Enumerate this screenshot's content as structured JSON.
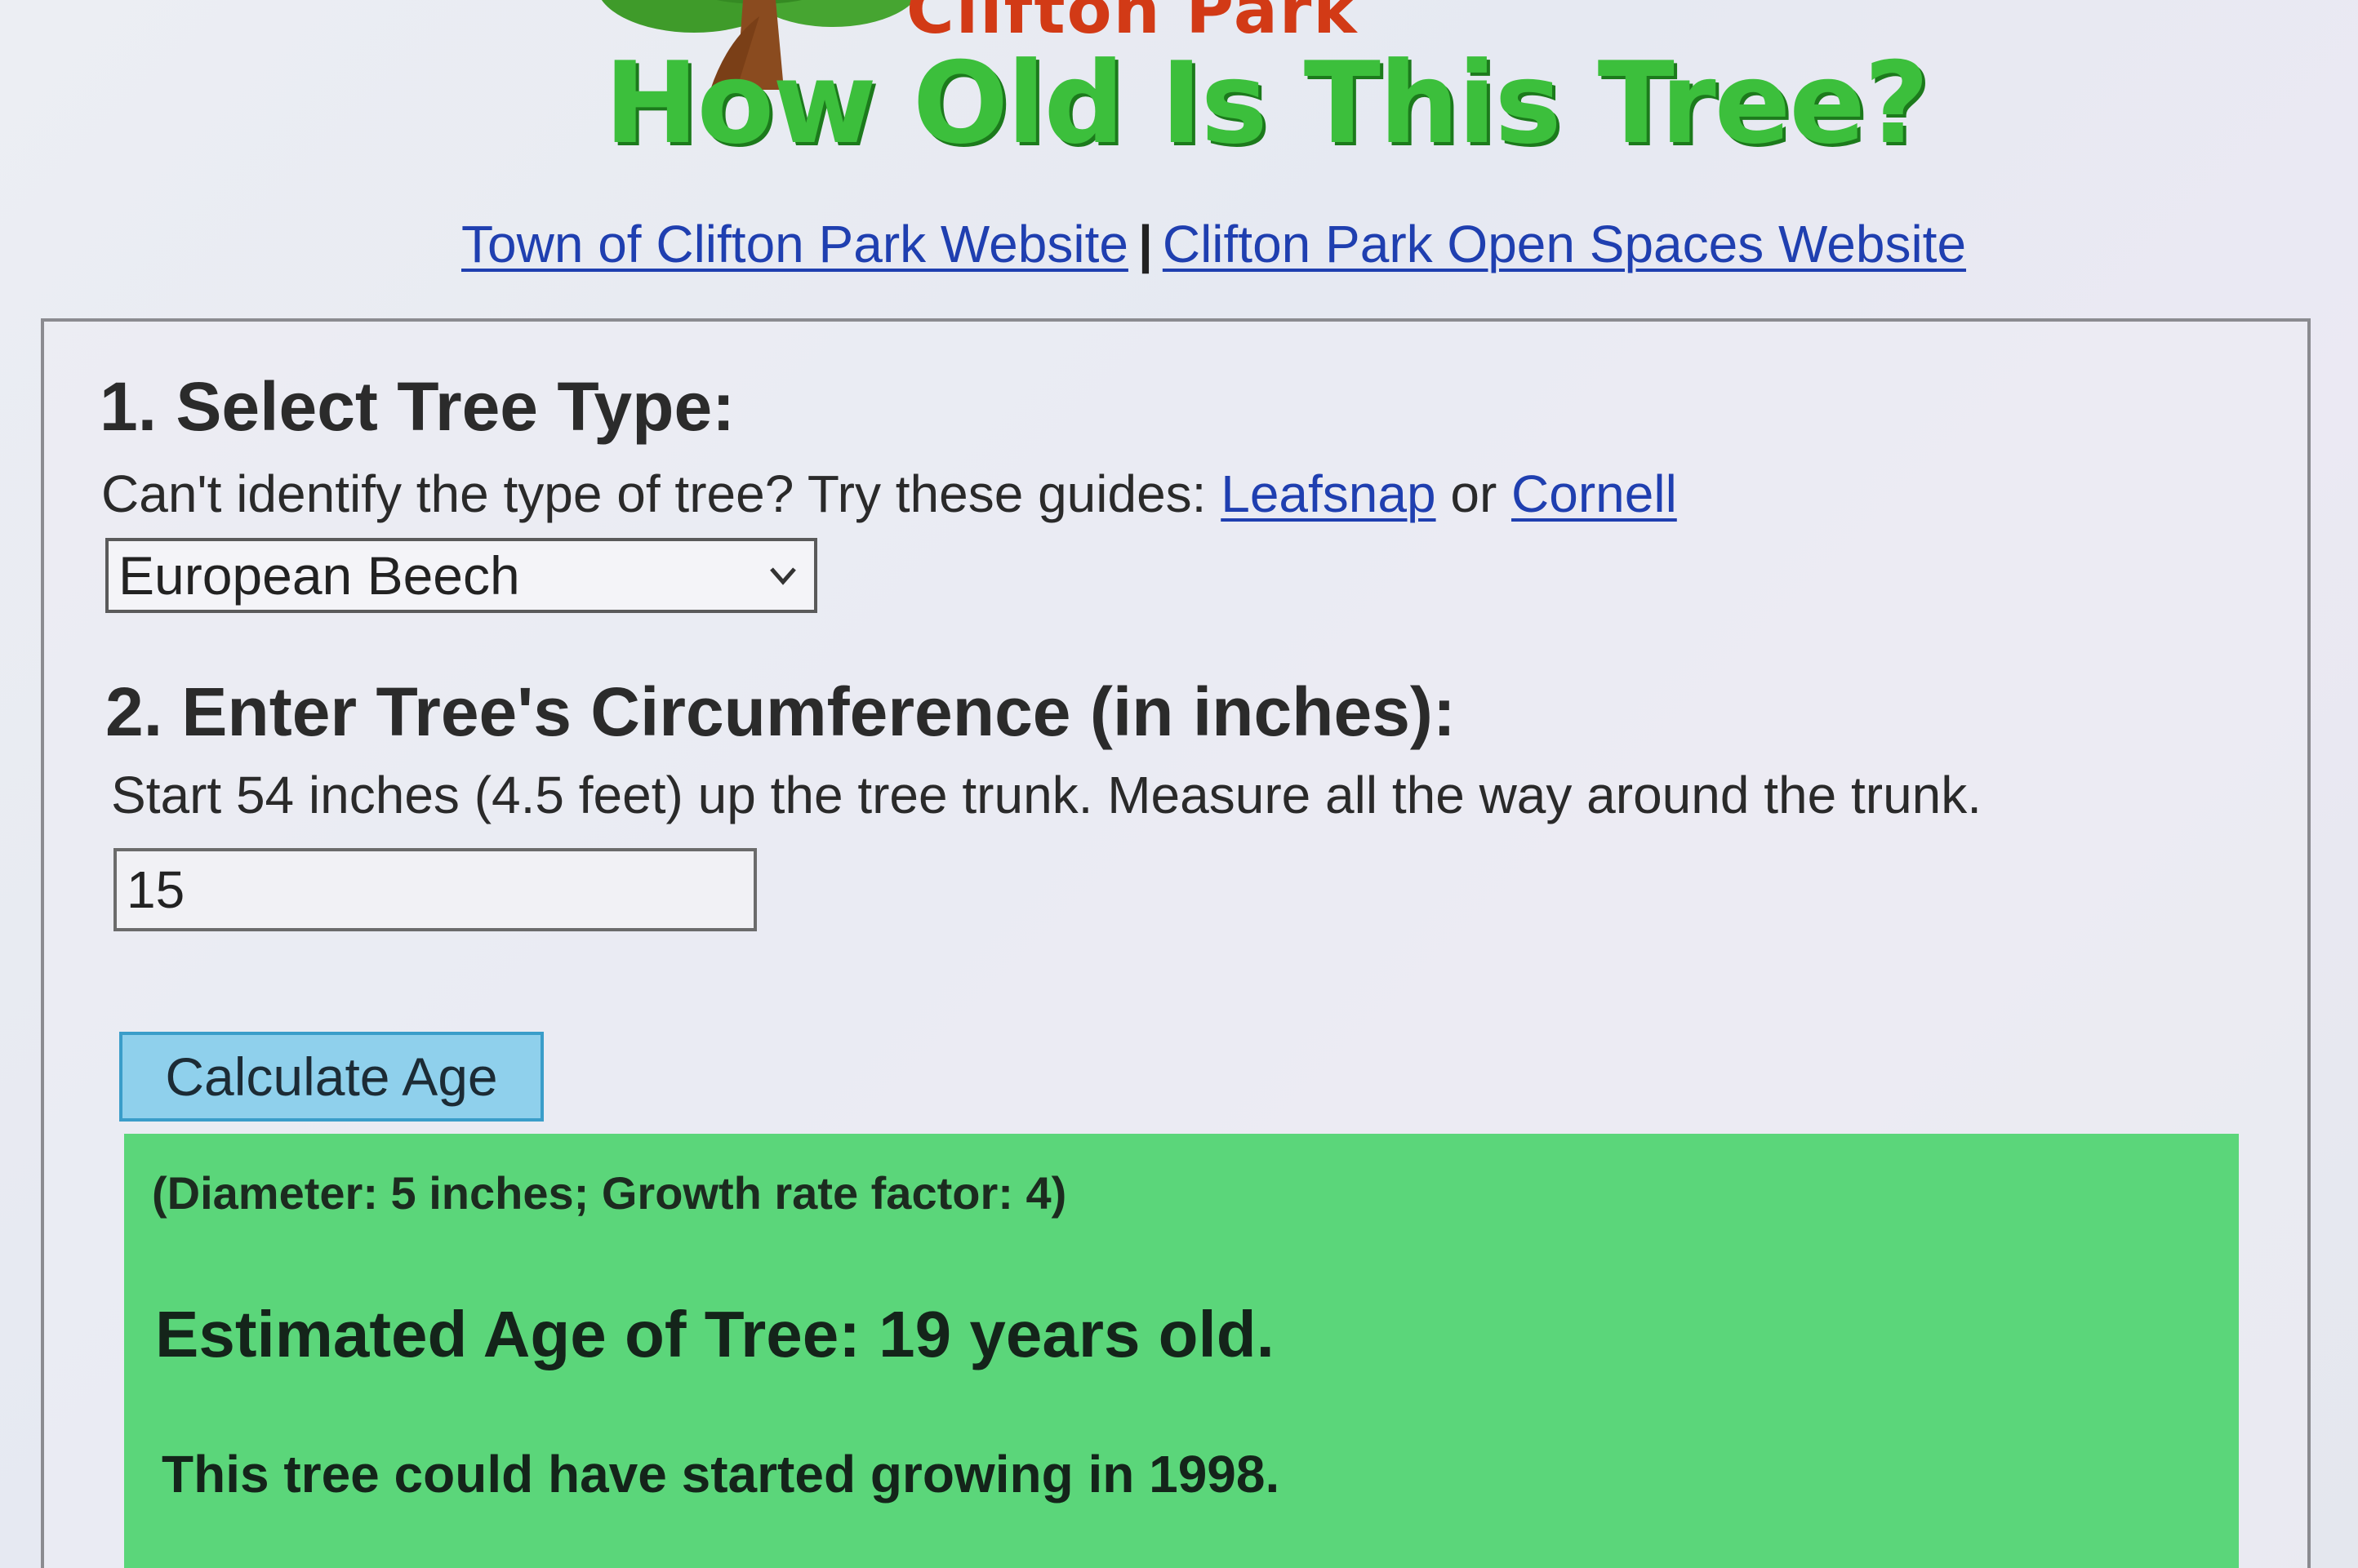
{
  "header": {
    "logo_text": "Clifton Park",
    "title": "How Old Is This Tree?",
    "links": [
      {
        "label": "Town of Clifton Park Website"
      },
      {
        "label": "Clifton Park Open Spaces Website"
      }
    ],
    "separator": "|"
  },
  "step1": {
    "heading": "1. Select Tree Type:",
    "guide_text": "Can't identify the type of tree? Try these guides:",
    "guide_link1": "Leafsnap",
    "guide_or": "or",
    "guide_link2": "Cornell",
    "selected_tree": "European Beech"
  },
  "step2": {
    "heading": "2. Enter Tree's Circumference (in inches):",
    "instructions": "Start 54 inches (4.5 feet) up the tree trunk. Measure all the way around the trunk.",
    "circumference_value": "15"
  },
  "button": {
    "calculate_label": "Calculate Age"
  },
  "result": {
    "details": "(Diameter: 5 inches; Growth rate factor: 4)",
    "age": "Estimated Age of Tree: 19 years old.",
    "start_year": "This tree could have started growing in 1998."
  },
  "colors": {
    "title_green": "#3cbf3c",
    "result_bg": "#5bd67a",
    "button_bg": "#8fd0ec",
    "link_blue": "#1f3fb0",
    "logo_red": "#d23a16"
  },
  "icons": {
    "logo": "tree-icon",
    "select_arrow": "chevron-down-icon"
  }
}
